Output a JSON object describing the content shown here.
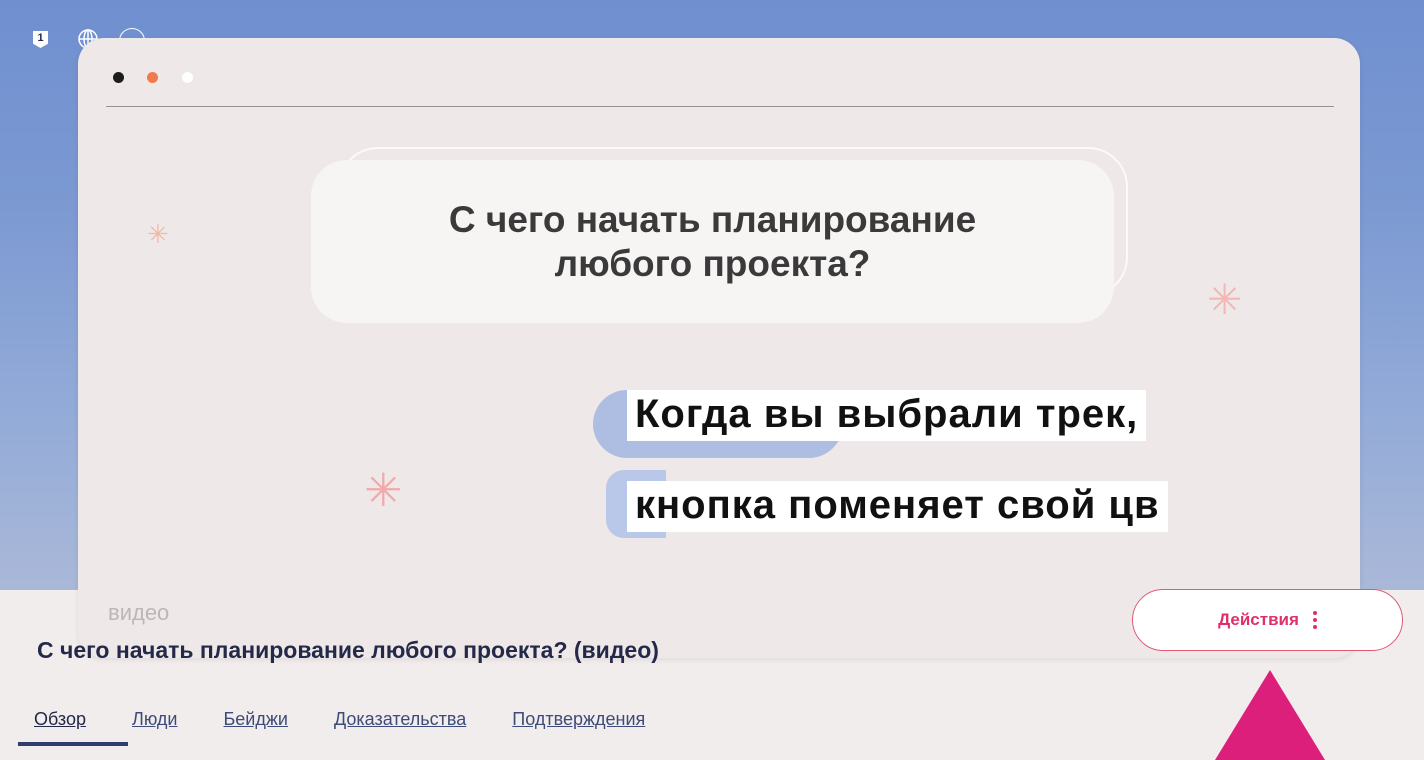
{
  "toolbar": {
    "badge_number": "1",
    "icons": [
      "globe-icon",
      "circle-icon"
    ]
  },
  "video": {
    "bubble_line1": "С чего начать планирование",
    "bubble_line2": "любого проекта?",
    "ghost_label": "видео",
    "window_dots": [
      "#1c1c1c",
      "#f07a4a",
      "#ffffff"
    ]
  },
  "overlay": {
    "caption_line1": "Когда вы выбрали трек,",
    "caption_line2": "кнопка поменяет свой цв"
  },
  "page": {
    "title": "С чего начать планирование любого проекта? (видео)",
    "actions_label": "Действия",
    "accent_color": "#e0306a"
  },
  "tabs": [
    {
      "label": "Обзор"
    },
    {
      "label": "Люди"
    },
    {
      "label": "Бейджи"
    },
    {
      "label": "Доказательства"
    },
    {
      "label": "Подтверждения"
    }
  ]
}
